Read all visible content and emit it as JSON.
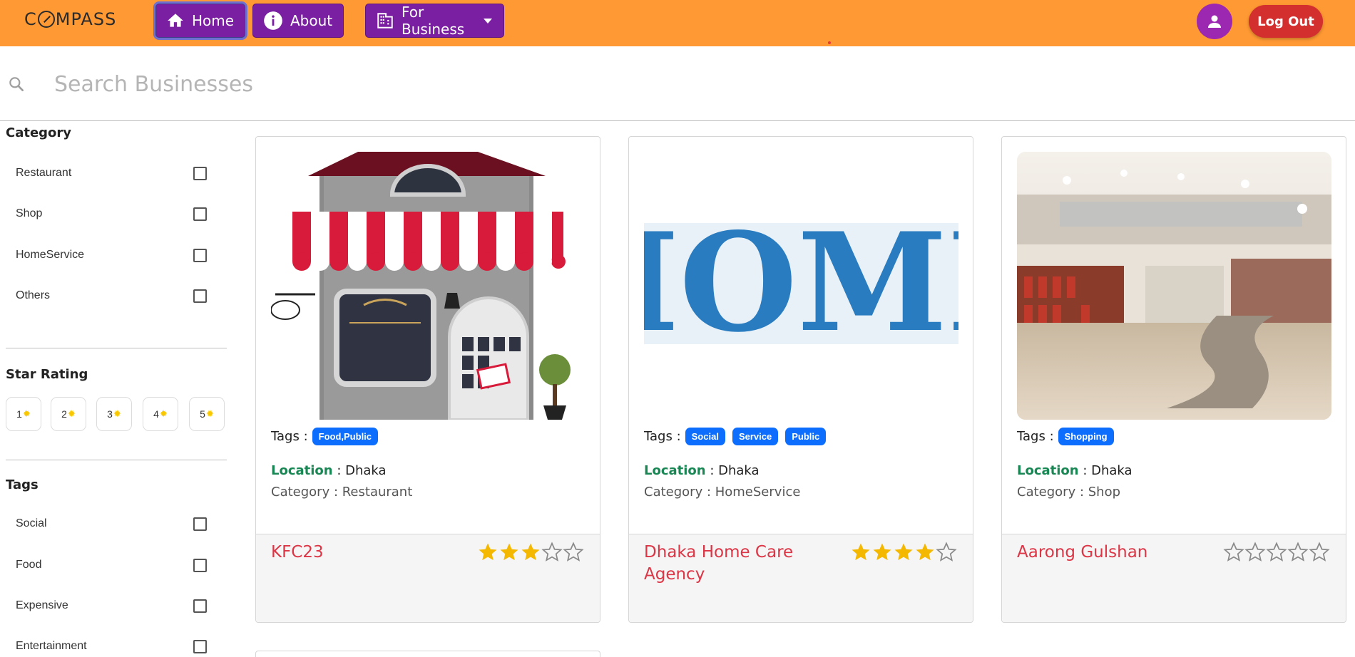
{
  "navbar": {
    "logo_text": "COMPASS",
    "home_label": "Home",
    "about_label": "About",
    "business_label": "For Business",
    "logout_label": "Log Out"
  },
  "search": {
    "placeholder": "Search Businesses"
  },
  "sidebar": {
    "category_title": "Category",
    "categories": [
      "Restaurant",
      "Shop",
      "HomeService",
      "Others"
    ],
    "rating_title": "Star Rating",
    "ratings": [
      "1",
      "2",
      "3",
      "4",
      "5"
    ],
    "tags_title": "Tags",
    "tags": [
      "Social",
      "Food",
      "Expensive",
      "Entertainment"
    ]
  },
  "cards": [
    {
      "tags_label": "Tags :",
      "tags": [
        "Food,Public"
      ],
      "location_key": "Location",
      "location_value": " : Dhaka",
      "category_text": "Category : Restaurant",
      "title": "KFC23",
      "rating": 3
    },
    {
      "tags_label": "Tags :",
      "tags": [
        "Social",
        "Service",
        "Public"
      ],
      "location_key": "Location",
      "location_value": " : Dhaka",
      "category_text": "Category : HomeService",
      "title": "Dhaka Home Care Agency",
      "rating": 4,
      "image_text": "HOME"
    },
    {
      "tags_label": "Tags :",
      "tags": [
        "Shopping"
      ],
      "location_key": "Location",
      "location_value": " : Dhaka",
      "category_text": "Category : Shop",
      "title": "Aarong Gulshan",
      "rating": 0
    }
  ],
  "colors": {
    "navbar": "#ff9933",
    "nav_button": "#7b1fa2",
    "logout": "#d32f2f",
    "badge": "#0d6efd",
    "title": "#dc3545",
    "location": "#198754",
    "star": "#f5b800"
  }
}
